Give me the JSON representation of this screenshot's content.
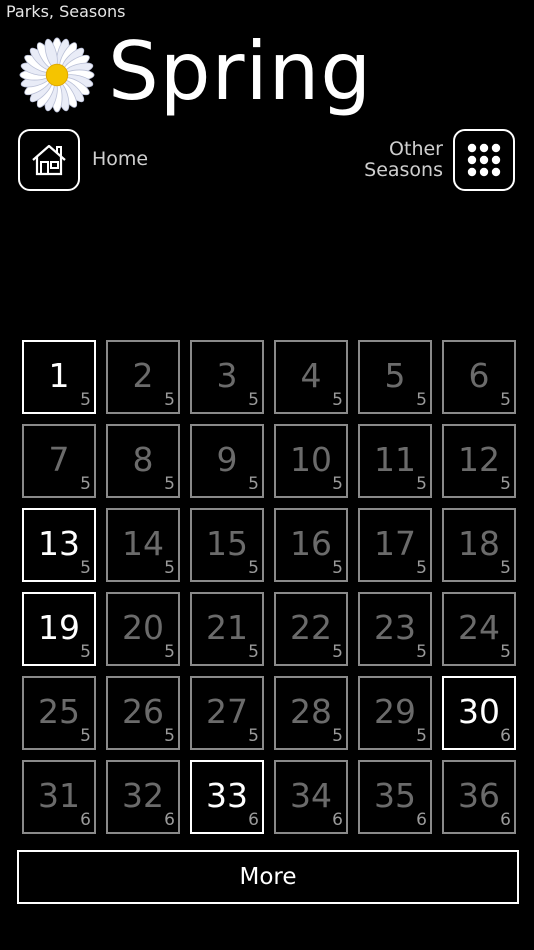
{
  "breadcrumb": "Parks, Seasons",
  "title": "Spring",
  "nav": {
    "home_label": "Home",
    "seasons_label_line1": "Other",
    "seasons_label_line2": "Seasons"
  },
  "levels": [
    {
      "num": "1",
      "sub": "5",
      "active": true
    },
    {
      "num": "2",
      "sub": "5",
      "active": false
    },
    {
      "num": "3",
      "sub": "5",
      "active": false
    },
    {
      "num": "4",
      "sub": "5",
      "active": false
    },
    {
      "num": "5",
      "sub": "5",
      "active": false
    },
    {
      "num": "6",
      "sub": "5",
      "active": false
    },
    {
      "num": "7",
      "sub": "5",
      "active": false
    },
    {
      "num": "8",
      "sub": "5",
      "active": false
    },
    {
      "num": "9",
      "sub": "5",
      "active": false
    },
    {
      "num": "10",
      "sub": "5",
      "active": false
    },
    {
      "num": "11",
      "sub": "5",
      "active": false
    },
    {
      "num": "12",
      "sub": "5",
      "active": false
    },
    {
      "num": "13",
      "sub": "5",
      "active": true
    },
    {
      "num": "14",
      "sub": "5",
      "active": false
    },
    {
      "num": "15",
      "sub": "5",
      "active": false
    },
    {
      "num": "16",
      "sub": "5",
      "active": false
    },
    {
      "num": "17",
      "sub": "5",
      "active": false
    },
    {
      "num": "18",
      "sub": "5",
      "active": false
    },
    {
      "num": "19",
      "sub": "5",
      "active": true
    },
    {
      "num": "20",
      "sub": "5",
      "active": false
    },
    {
      "num": "21",
      "sub": "5",
      "active": false
    },
    {
      "num": "22",
      "sub": "5",
      "active": false
    },
    {
      "num": "23",
      "sub": "5",
      "active": false
    },
    {
      "num": "24",
      "sub": "5",
      "active": false
    },
    {
      "num": "25",
      "sub": "5",
      "active": false
    },
    {
      "num": "26",
      "sub": "5",
      "active": false
    },
    {
      "num": "27",
      "sub": "5",
      "active": false
    },
    {
      "num": "28",
      "sub": "5",
      "active": false
    },
    {
      "num": "29",
      "sub": "5",
      "active": false
    },
    {
      "num": "30",
      "sub": "6",
      "active": true
    },
    {
      "num": "31",
      "sub": "6",
      "active": false
    },
    {
      "num": "32",
      "sub": "6",
      "active": false
    },
    {
      "num": "33",
      "sub": "6",
      "active": true
    },
    {
      "num": "34",
      "sub": "6",
      "active": false
    },
    {
      "num": "35",
      "sub": "6",
      "active": false
    },
    {
      "num": "36",
      "sub": "6",
      "active": false
    }
  ],
  "more_label": "More",
  "colors": {
    "background": "#000000",
    "active": "#ffffff",
    "inactive": "#6b6b6b",
    "flower_center": "#f5c400"
  }
}
